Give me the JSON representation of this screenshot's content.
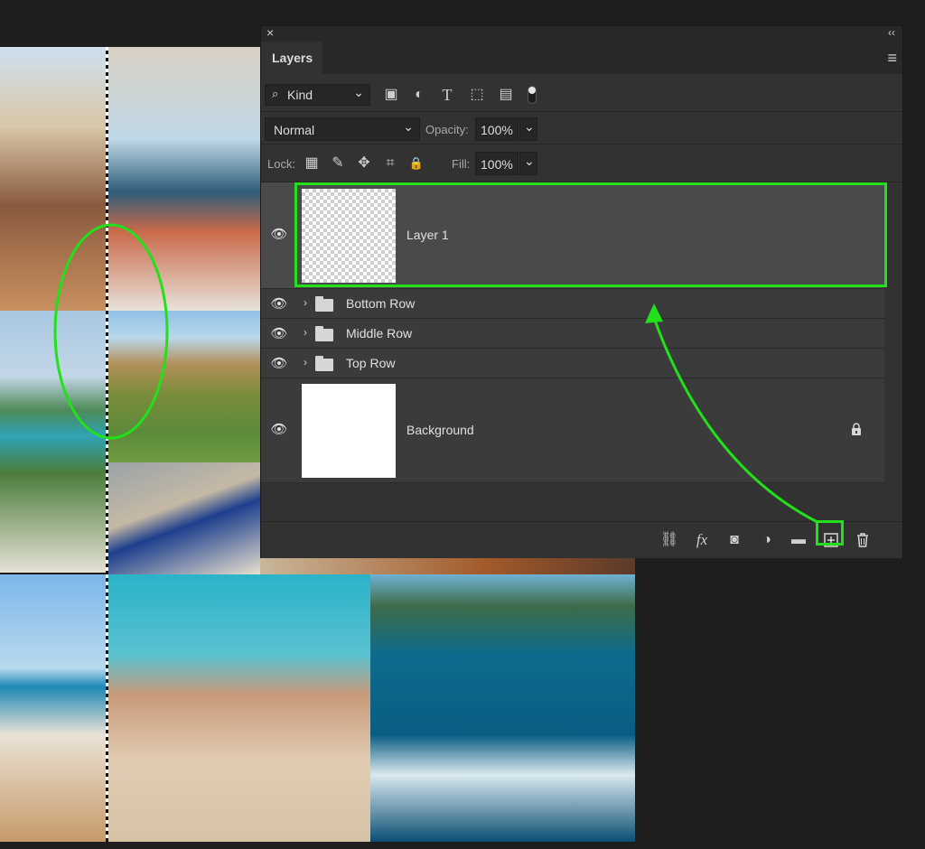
{
  "panel": {
    "close_glyph": "×",
    "collapse_glyph": "‹‹",
    "tab_label": "Layers",
    "menu_glyph": "≡"
  },
  "filter": {
    "kind_label": "Kind",
    "icons": [
      "image-filter-icon",
      "adjustment-filter-icon",
      "type-filter-icon",
      "shape-filter-icon",
      "smart-object-filter-icon",
      "filter-toggle-icon"
    ]
  },
  "blend": {
    "mode": "Normal",
    "opacity_label": "Opacity:",
    "opacity_value": "100%"
  },
  "lock": {
    "label": "Lock:",
    "fill_label": "Fill:",
    "fill_value": "100%"
  },
  "layers": [
    {
      "name": "Layer 1",
      "type": "pixel",
      "visible": true
    },
    {
      "name": "Bottom Row",
      "type": "group",
      "visible": true
    },
    {
      "name": "Middle Row",
      "type": "group",
      "visible": true
    },
    {
      "name": "Top Row",
      "type": "group",
      "visible": true
    },
    {
      "name": "Background",
      "type": "background",
      "visible": true,
      "locked": true
    }
  ],
  "bottom_icons": [
    "link-icon",
    "fx-icon",
    "mask-icon",
    "adjustment-layer-icon",
    "group-folder-icon",
    "new-layer-icon",
    "trash-icon"
  ],
  "bottom_labels": {
    "fx": "fx"
  },
  "glyphs": {
    "eye": "👁",
    "caret": "›",
    "dropdown": "⌄",
    "lock": "🔒"
  },
  "annotation": {
    "color": "#22e01a"
  },
  "colors": {
    "panel_bg": "#323232",
    "row_bg": "#3b3b3b",
    "highlight": "#22e01a"
  }
}
